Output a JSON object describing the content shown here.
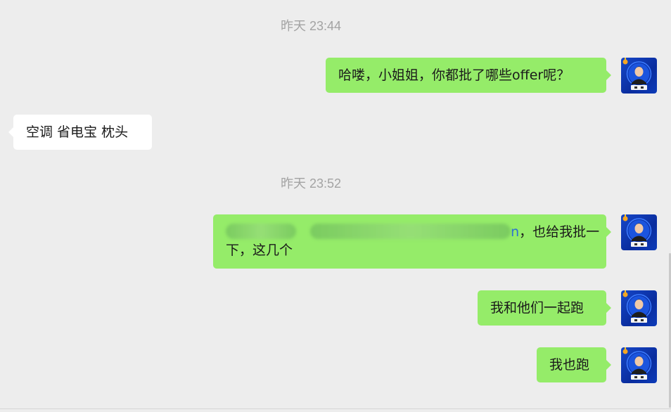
{
  "timestamps": [
    "昨天 23:44",
    "昨天 23:52"
  ],
  "messages": [
    {
      "direction": "out",
      "text": "哈喽，小姐姐，你都批了哪些offer呢？"
    },
    {
      "direction": "in",
      "text": "空调 省电宝 枕头"
    },
    {
      "direction": "out",
      "line1_suffix": "，也给我批一",
      "line2": "下，这几个",
      "link_fragment": "n"
    },
    {
      "direction": "out",
      "text": "我和他们一起跑"
    },
    {
      "direction": "out",
      "text": "我也跑"
    }
  ],
  "avatar": {
    "icon": "user-avatar-icon",
    "bg_color": "#1647c9"
  },
  "colors": {
    "outgoing_bubble": "#95ec69",
    "incoming_bubble": "#ffffff",
    "background": "#ededed",
    "timestamp": "#a3a3a3"
  }
}
